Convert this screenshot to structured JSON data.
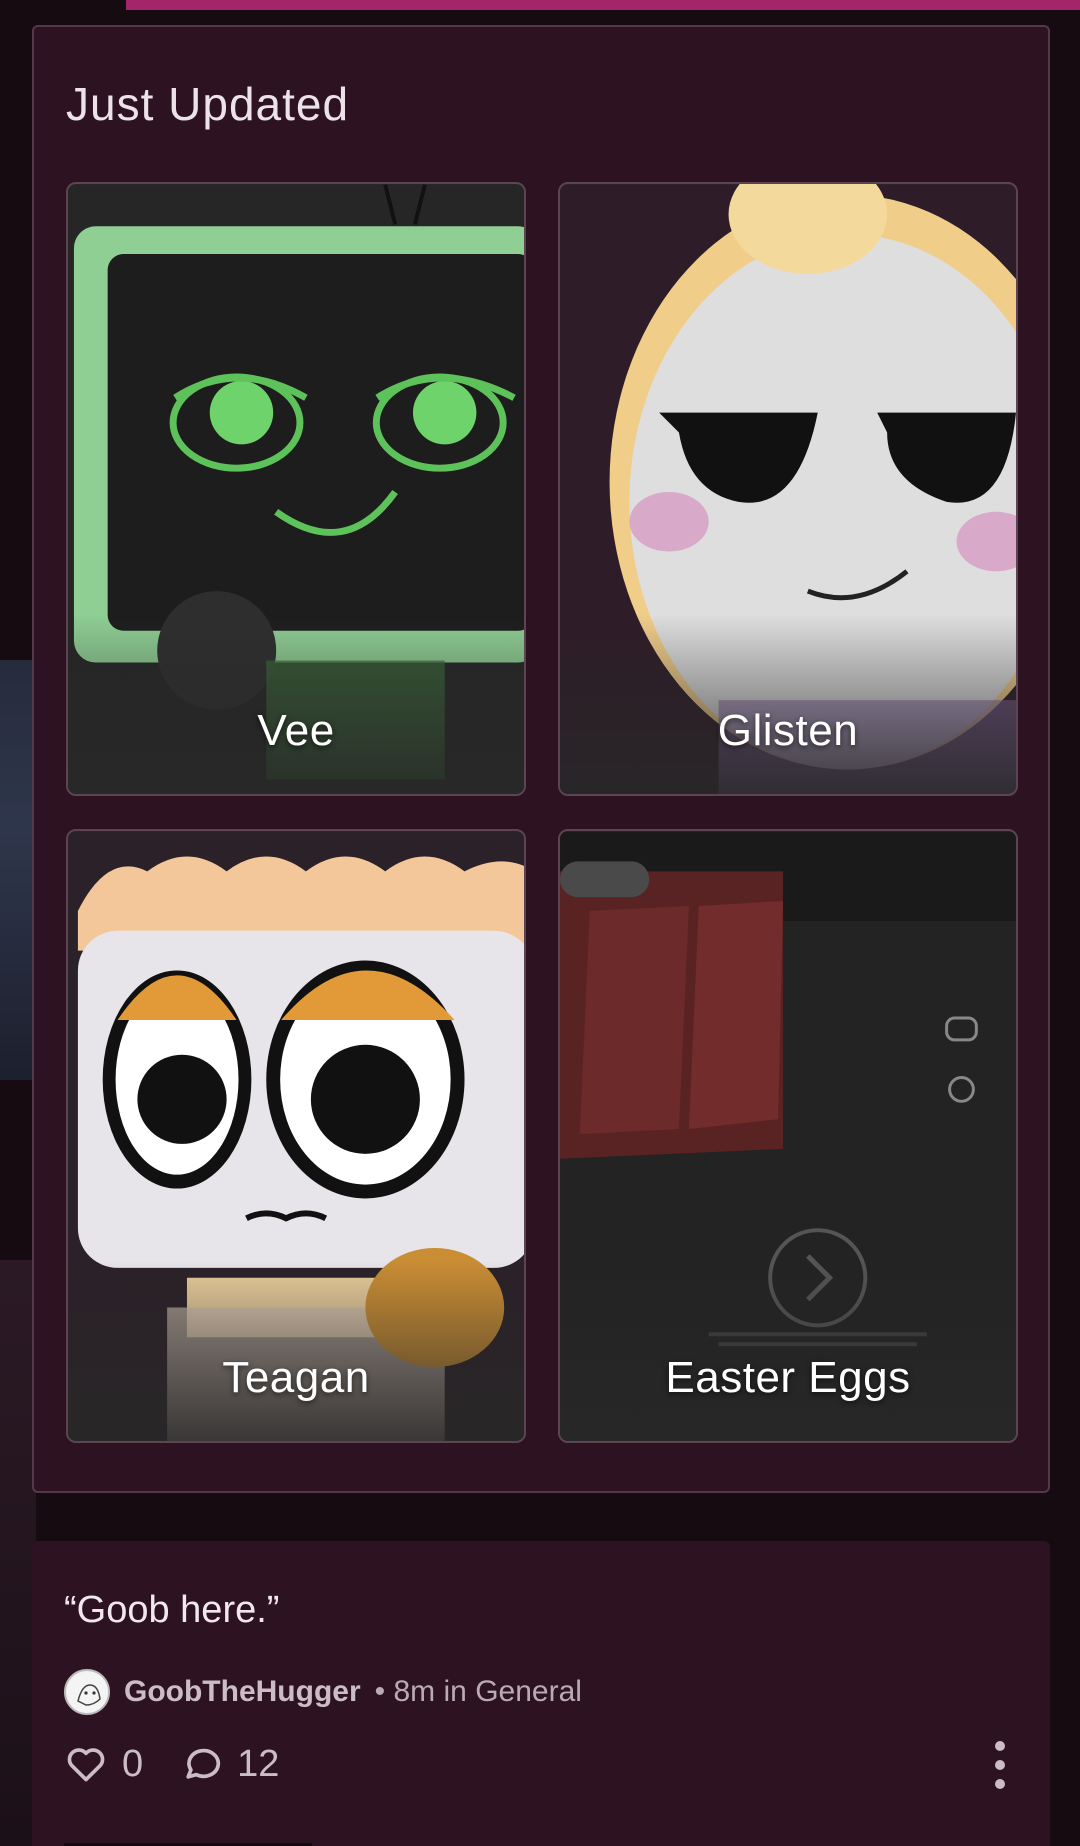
{
  "section": {
    "title": "Just Updated",
    "cards": [
      {
        "label": "Vee"
      },
      {
        "label": "Glisten"
      },
      {
        "label": "Teagan"
      },
      {
        "label": "Easter Eggs"
      }
    ]
  },
  "post": {
    "title": "“Goob here.”",
    "author": "GoobTheHugger",
    "meta": "• 8m in General",
    "likes": "0",
    "comments": "12"
  },
  "colors": {
    "accent": "#a3266a",
    "panel": "#2d1322",
    "background": "#170b12"
  },
  "icons": [
    "heart-icon",
    "comment-icon",
    "more-vertical-icon",
    "avatar"
  ]
}
